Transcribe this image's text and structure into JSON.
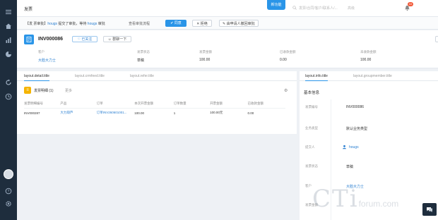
{
  "app": {
    "page_title": "发票",
    "new_button": "新功能"
  },
  "top": {
    "search_placeholder": "发票/合同/客户/联系人/...",
    "search_extra": "高级",
    "notification_count": "10"
  },
  "approval": {
    "prefix": "【发 票审批】",
    "user1": "hougs",
    "mid": " 提交了审批，等待 ",
    "user2": "hougs",
    "suffix": " 审批",
    "view_link": "查看审批流程",
    "agree": "✔ 同意",
    "reject": "✕ 拒绝",
    "withdraw": "✎ 由申请人撤回审批"
  },
  "header": {
    "record_name": "INV000086",
    "follow": "♡ 已关注",
    "chat": "☺ 群聊一下",
    "more": "…",
    "fields": [
      {
        "label": "客户",
        "value": "大脸大力士",
        "link": true
      },
      {
        "label": "发票状态",
        "value": "草稿",
        "link": false
      },
      {
        "label": "发票金额",
        "value": "100.00",
        "link": false
      },
      {
        "label": "已收款金额",
        "value": "0.00",
        "link": false
      },
      {
        "label": "未收款金额",
        "value": "100.00",
        "link": false
      }
    ]
  },
  "left_tabs": [
    "layout.detail.title",
    "layout.crmfeed.title",
    "layout.refer.title"
  ],
  "section": {
    "title": "发票明细 (1)",
    "more": "更多"
  },
  "table": {
    "headers": [
      "发票明细编号",
      "产品",
      "订单",
      "本次开票金额",
      "订单数量",
      "开票金额",
      "已收款金额"
    ],
    "rows": [
      [
        "INV000287",
        "大力葫芦",
        "订单INV260601001...",
        "100.00",
        "1",
        "100.00元",
        "0.00"
      ]
    ]
  },
  "right_tabs": [
    "layout.info.title",
    "layout.groupmember.title"
  ],
  "info": {
    "title": "基本信息",
    "rows": [
      {
        "label": "发票编号",
        "value": "INV000086",
        "type": "text"
      },
      {
        "label": "业务类型",
        "value": "默认业务类型",
        "type": "text"
      },
      {
        "label": "提交人",
        "value": "hougs",
        "type": "user"
      },
      {
        "label": "发票状态",
        "value": "草稿",
        "type": "text"
      },
      {
        "label": "客户",
        "value": "大脸大力士",
        "type": "link"
      },
      {
        "label": "发票金额",
        "value": "",
        "type": "text"
      }
    ]
  },
  "watermark": {
    "big": "CTi",
    "small": "forum.com"
  },
  "colors": {
    "primary": "#2a95e8",
    "rail": "#1e2d3d",
    "link": "#2a7fd1",
    "section_icon": "#f5b400"
  }
}
